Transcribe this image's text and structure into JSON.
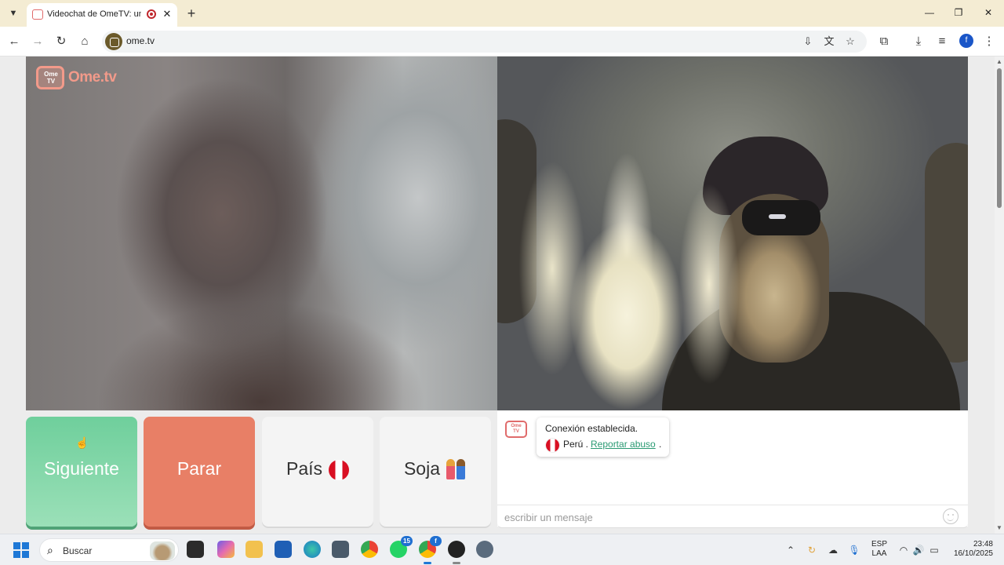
{
  "browser": {
    "tab": {
      "title": "Videochat de OmeTV: una a",
      "close_glyph": "✕"
    },
    "new_tab_glyph": "+",
    "window_controls": [
      "—",
      "❐",
      "✕"
    ],
    "url": "ome.tv",
    "profile_initial": "f"
  },
  "page": {
    "logo_tv_text": "Ome TV",
    "logo_text": "Ome.tv",
    "buttons": {
      "next": "Siguiente",
      "stop": "Parar",
      "country": "País",
      "gender": "Soja"
    },
    "chat": {
      "logo_text": "Ome TV",
      "connection_message": "Conexión establecida.",
      "country": "Perú .",
      "report_link": "Reportar abuso",
      "report_suffix": ".",
      "input_placeholder": "escribir un mensaje"
    }
  },
  "taskbar": {
    "search_placeholder": "Buscar",
    "whatsapp_badge": "15",
    "chrome_badge": "f",
    "language": "ESP",
    "layout": "LAA",
    "time": "23:48",
    "date": "16/10/2025"
  },
  "colors": {
    "next_button": "#6fcf9c",
    "stop_button": "#e87f66",
    "report_link": "#2a9a73",
    "tab_strip": "#f4ecd3"
  }
}
